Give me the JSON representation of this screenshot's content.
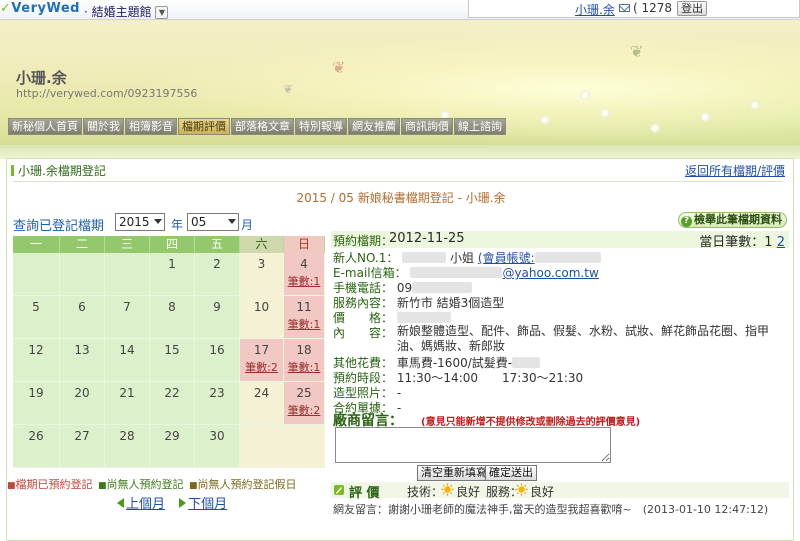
{
  "topbar": {
    "logo": "VeryWed",
    "theme": "結婚主題館",
    "username": "小珊.余",
    "mail_count": "( 1278 )",
    "logout": "登出"
  },
  "banner": {
    "site_name": "小珊.余",
    "site_url": "http://verywed.com/0923197556"
  },
  "nav": [
    {
      "label": "新秘個人首頁"
    },
    {
      "label": "關於我"
    },
    {
      "label": "相簿影音"
    },
    {
      "label": "檔期評價",
      "active": true
    },
    {
      "label": "部落格文章"
    },
    {
      "label": "特別報導"
    },
    {
      "label": "網友推薦"
    },
    {
      "label": "商訊詢價"
    },
    {
      "label": "線上諮詢"
    }
  ],
  "section": {
    "title": "小珊.余檔期登記",
    "back_link": "返回所有檔期/評價",
    "sub_title": "2015 / 05 新娘秘書檔期登記 - 小珊.余"
  },
  "query": {
    "label": "查詢已登記檔期",
    "year": "2015",
    "year_suffix": "年",
    "month": "05",
    "month_suffix": "月"
  },
  "calendar": {
    "weekdays": [
      "一",
      "二",
      "三",
      "四",
      "五",
      "六",
      "日"
    ],
    "weeks": [
      [
        {
          "d": ""
        },
        {
          "d": ""
        },
        {
          "d": ""
        },
        {
          "d": "1"
        },
        {
          "d": "2"
        },
        {
          "d": "3"
        },
        {
          "d": "4",
          "count": "筆數:1"
        }
      ],
      [
        {
          "d": "5"
        },
        {
          "d": "6"
        },
        {
          "d": "7"
        },
        {
          "d": "8"
        },
        {
          "d": "9"
        },
        {
          "d": "10"
        },
        {
          "d": "11",
          "count": "筆數:1"
        }
      ],
      [
        {
          "d": "12"
        },
        {
          "d": "13"
        },
        {
          "d": "14"
        },
        {
          "d": "15"
        },
        {
          "d": "16"
        },
        {
          "d": "17",
          "count": "筆數:2"
        },
        {
          "d": "18",
          "count": "筆數:1"
        }
      ],
      [
        {
          "d": "19"
        },
        {
          "d": "20"
        },
        {
          "d": "21"
        },
        {
          "d": "22"
        },
        {
          "d": "23"
        },
        {
          "d": "24"
        },
        {
          "d": "25",
          "count": "筆數:2"
        }
      ],
      [
        {
          "d": "26"
        },
        {
          "d": "27"
        },
        {
          "d": "28"
        },
        {
          "d": "29"
        },
        {
          "d": "30"
        },
        {
          "d": ""
        },
        {
          "d": ""
        }
      ]
    ],
    "legend": {
      "booked": "檔期已預約登記",
      "free": "尚無人預約登記",
      "free_holiday": "尚無人預約登記假日"
    },
    "prev": "上個月",
    "next": "下個月"
  },
  "detail": {
    "btn": "檢舉此筆檔期資料",
    "date_label": "預約檔期：",
    "date_value": "2012-11-25",
    "day_count_label": "當日筆數：",
    "day_count_pages": [
      "1",
      "2"
    ],
    "bride_label": "新人NO.1：",
    "bride_suffix": "小姐",
    "member_link": "(會員帳號:",
    "email_label": "E-mail信箱：",
    "email_suffix": "@yahoo.com.tw",
    "phone_label": "手機電話：",
    "phone_value": "09",
    "service_label": "服務內容：",
    "service_value": "新竹市 結婚3個造型",
    "price_label": "價　　格：",
    "content_label": "內　　容：",
    "content_value": "新娘整體造型、配件、飾品、假髮、水粉、試妝、鮮花飾品花圈、指甲油、媽媽妝、新郎妝",
    "other_label": "其他花費：",
    "other_value": "車馬費-1600/試髮費-",
    "time_label": "預約時段：",
    "time_value": "11:30～14:00　　17:30～21:30",
    "photo_label": "造型照片：",
    "photo_value": "-",
    "contract_label": "合約單據：",
    "contract_value": "-",
    "msg_title": "廠商留言：",
    "msg_note": "(意見只能新增不提供修改或刪除過去的評價意見)",
    "btn_clear": "清空重新填寫",
    "btn_submit": "確定送出",
    "rate_title": "評 價",
    "rate_tech_label": "技術：",
    "rate_tech_value": "良好",
    "rate_svc_label": "服務：",
    "rate_svc_value": "良好",
    "comment": "網友留言：謝謝小珊老師的魔法神手,當天的造型我超喜歡唷~　(2013-01-10 12:47:12)"
  }
}
